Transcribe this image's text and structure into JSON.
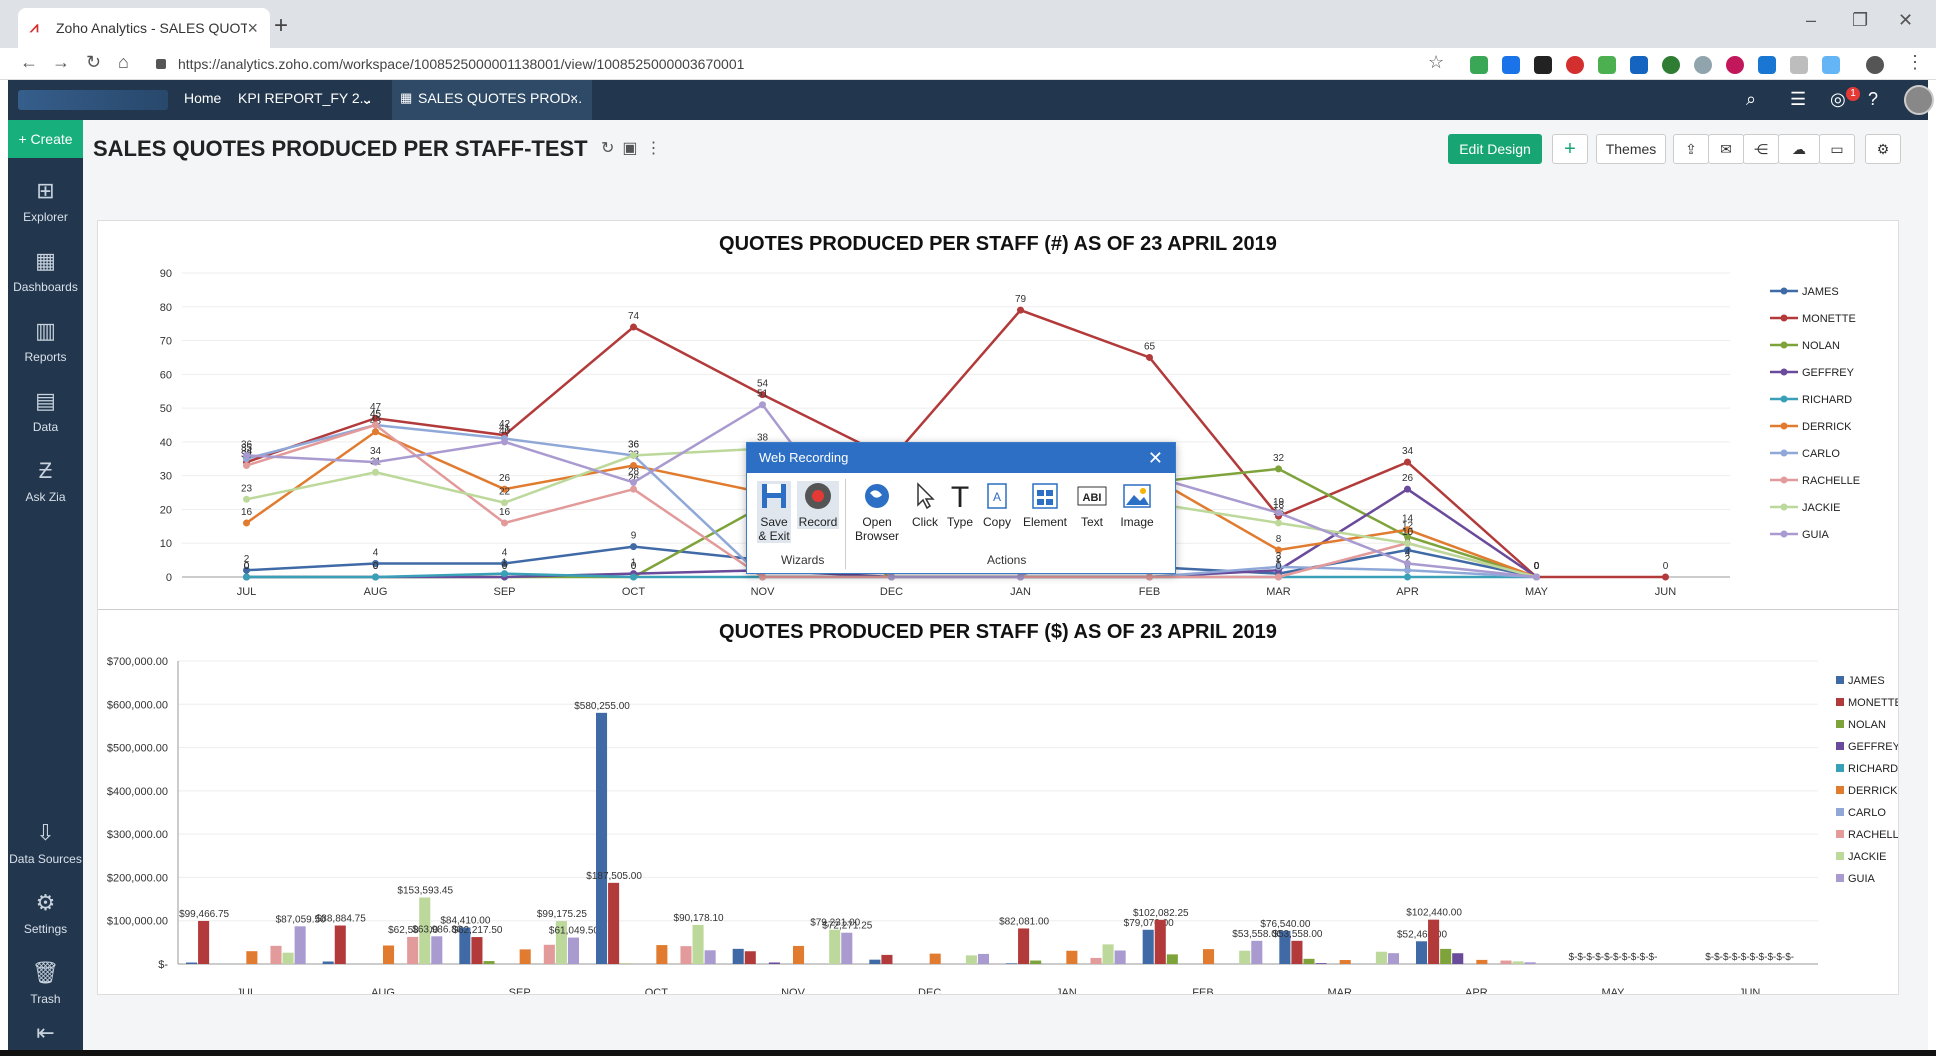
{
  "browser": {
    "tab_title": "Zoho Analytics - SALES QUOTES",
    "url": "https://analytics.zoho.com/workspace/1008525000001138001/view/1008525000003670001"
  },
  "header": {
    "nav": [
      "Home",
      "KPI REPORT_FY 2...",
      "SALES QUOTES PROD..."
    ],
    "notif_count": "1"
  },
  "sidebar": {
    "create": "Create",
    "items": [
      "Explorer",
      "Dashboards",
      "Reports",
      "Data",
      "Ask Zia",
      "Data Sources",
      "Settings",
      "Trash"
    ]
  },
  "toolbar": {
    "title": "SALES QUOTES PRODUCED PER STAFF-TEST",
    "edit_design": "Edit Design",
    "themes": "Themes"
  },
  "popup": {
    "title": "Web Recording",
    "buttons": [
      "Save & Exit",
      "Record",
      "Open Browser",
      "Click",
      "Type",
      "Copy",
      "Element",
      "Text",
      "Image"
    ],
    "groups": [
      "Wizards",
      "Actions"
    ]
  },
  "colors": {
    "JAMES": "#3f6aa6",
    "MONETTE": "#b23a3a",
    "NOLAN": "#7ea33a",
    "GEFFREY": "#6a4a9a",
    "RICHARD": "#3aa0b8",
    "DERRICK": "#e07b2f",
    "CARLO": "#8fa8d8",
    "RACHELLE": "#e39a9a",
    "JACKIE": "#bcd89a",
    "GUIA": "#a99ad0"
  },
  "chart_data": [
    {
      "type": "line",
      "title": "QUOTES PRODUCED PER STAFF (#) AS OF 23 APRIL 2019",
      "categories": [
        "JUL",
        "AUG",
        "SEP",
        "OCT",
        "NOV",
        "DEC",
        "JAN",
        "FEB",
        "MAR",
        "APR",
        "MAY",
        "JUN"
      ],
      "yticks": [
        "0",
        "10",
        "20",
        "30",
        "40",
        "50",
        "60",
        "70",
        "80",
        "90"
      ],
      "ylim": [
        0,
        90
      ],
      "legend": "right",
      "series": [
        {
          "name": "JAMES",
          "values": [
            2,
            4,
            4,
            9,
            5,
            3,
            2,
            3,
            1,
            8,
            0,
            null
          ]
        },
        {
          "name": "MONETTE",
          "values": [
            34,
            47,
            42,
            74,
            54,
            35,
            79,
            65,
            18,
            34,
            0,
            0
          ]
        },
        {
          "name": "NOLAN",
          "values": [
            0,
            0,
            0,
            0,
            21,
            0,
            0,
            28,
            32,
            12,
            0,
            null
          ]
        },
        {
          "name": "GEFFREY",
          "values": [
            0,
            0,
            0,
            1,
            2,
            0,
            0,
            0,
            2,
            26,
            0,
            null
          ]
        },
        {
          "name": "RICHARD",
          "values": [
            0,
            0,
            1,
            0,
            0,
            0,
            0,
            0,
            0,
            0,
            0,
            null
          ]
        },
        {
          "name": "DERRICK",
          "values": [
            16,
            43,
            26,
            33,
            25,
            0,
            0,
            30,
            8,
            14,
            0,
            null
          ]
        },
        {
          "name": "CARLO",
          "values": [
            35,
            45,
            41,
            36,
            0,
            0,
            0,
            0,
            3,
            2,
            0,
            null
          ]
        },
        {
          "name": "RACHELLE",
          "values": [
            33,
            45,
            16,
            26,
            0,
            0,
            0,
            0,
            0,
            10,
            0,
            null
          ]
        },
        {
          "name": "JACKIE",
          "values": [
            23,
            31,
            22,
            36,
            38,
            0,
            0,
            22,
            16,
            10,
            0,
            null
          ]
        },
        {
          "name": "GUIA",
          "values": [
            36,
            34,
            40,
            28,
            51,
            0,
            0,
            30,
            19,
            4,
            0,
            null
          ]
        }
      ]
    },
    {
      "type": "bar",
      "title": "QUOTES PRODUCED PER STAFF ($) AS OF 23 APRIL 2019",
      "categories": [
        "JUL",
        "AUG",
        "SEP",
        "OCT",
        "NOV",
        "DEC",
        "JAN",
        "FEB",
        "MAR",
        "APR",
        "MAY",
        "JUN"
      ],
      "yticks": [
        "$-",
        "$100,000.00",
        "$200,000.00",
        "$300,000.00",
        "$400,000.00",
        "$500,000.00",
        "$600,000.00",
        "$700,000.00"
      ],
      "ylim": [
        0,
        700000
      ],
      "legend": "right",
      "empty_label": "$-$-$-$-$-$-$-$-$-$-",
      "series": [
        {
          "name": "JAMES",
          "values": [
            3400,
            5785,
            84410,
            580255,
            35000,
            10000,
            1575,
            79070,
            76540,
            52460,
            0,
            0
          ]
        },
        {
          "name": "MONETTE",
          "values": [
            99466.75,
            88884.75,
            62217.5,
            187505,
            29445,
            21037,
            82081,
            102082.25,
            53558,
            102440,
            0,
            0
          ]
        },
        {
          "name": "NOLAN",
          "values": [
            0,
            0,
            6800,
            1090,
            0,
            0,
            8000,
            22256,
            12000,
            34870,
            0,
            0
          ]
        },
        {
          "name": "GEFFREY",
          "values": [
            0,
            0,
            0,
            0,
            3505,
            0,
            0,
            0,
            1996,
            24870,
            0,
            0
          ]
        },
        {
          "name": "RICHARD",
          "values": [
            0,
            0,
            0,
            0,
            0,
            0,
            0,
            0,
            0,
            0,
            0,
            0
          ]
        },
        {
          "name": "DERRICK",
          "values": [
            29600,
            42756.25,
            33752,
            43710,
            41725,
            23953,
            30581,
            34385,
            9190,
            9461,
            0,
            0
          ]
        },
        {
          "name": "CARLO",
          "values": [
            0,
            0,
            0,
            0,
            0,
            0,
            0,
            0,
            0,
            0,
            0,
            0
          ]
        },
        {
          "name": "RACHELLE",
          "values": [
            41930.25,
            62581,
            44438,
            41265,
            0,
            0,
            14000,
            0,
            0,
            8000,
            0,
            0
          ]
        },
        {
          "name": "JACKIE",
          "values": [
            26117.2,
            153593.45,
            99175.25,
            90178.1,
            79231,
            20000,
            45349.45,
            30805,
            28357.5,
            6000,
            0,
            0
          ]
        },
        {
          "name": "GUIA",
          "values": [
            87059.5,
            63986.8,
            61049.5,
            31672,
            72271.25,
            23264,
            31209,
            53558,
            25000,
            4000,
            0,
            0
          ]
        }
      ]
    }
  ]
}
